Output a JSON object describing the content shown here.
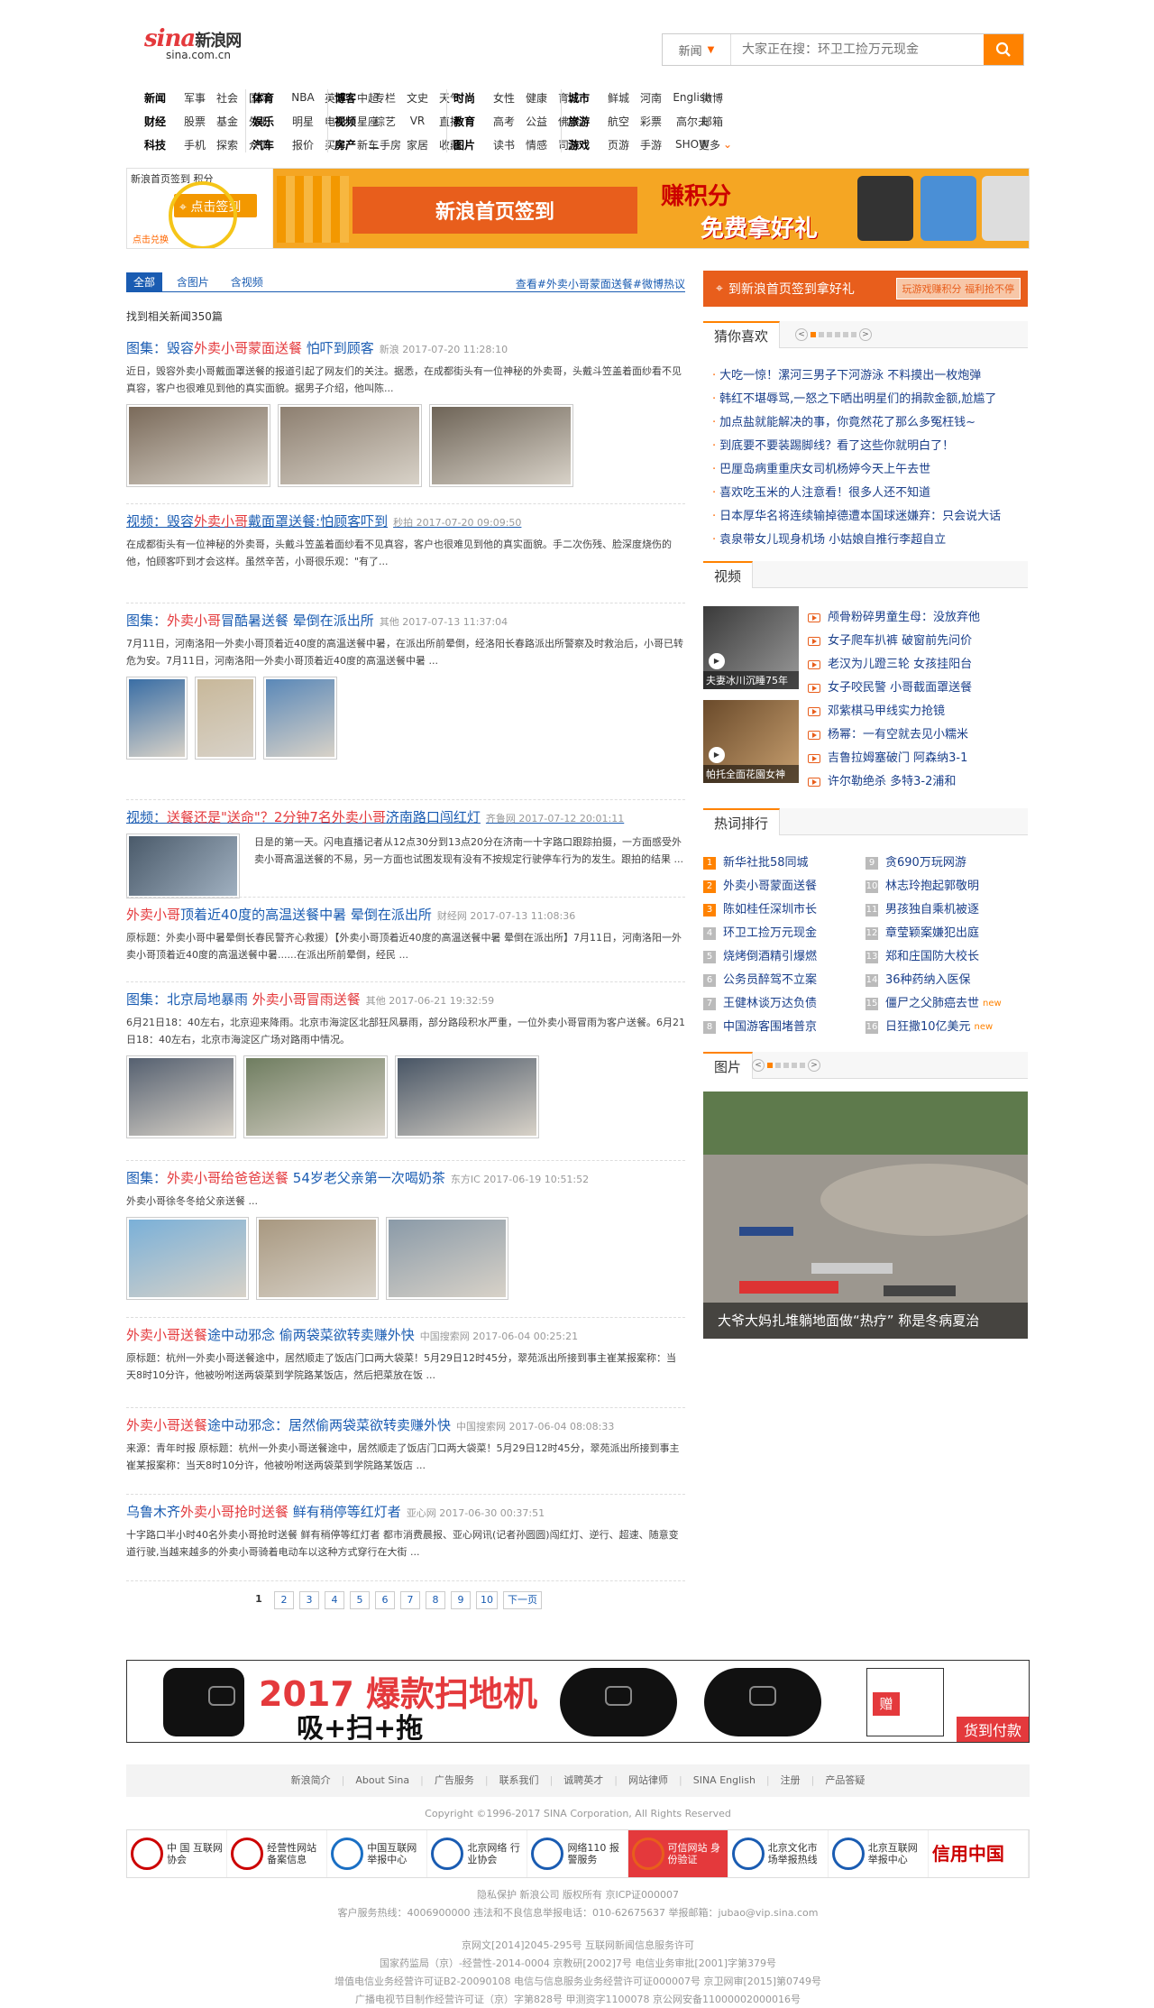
{
  "logo": {
    "brand": "sina",
    "cn": "新浪网",
    "domain": "sina.com.cn"
  },
  "search": {
    "category": "新闻",
    "placeholder": "大家正在搜：环卫工捡万元现金"
  },
  "nav": {
    "g1": [
      [
        "新闻",
        "军事",
        "社会",
        "国际"
      ],
      [
        "财经",
        "股票",
        "基金",
        "外汇"
      ],
      [
        "科技",
        "手机",
        "探索",
        "众测"
      ]
    ],
    "g2": [
      [
        "体育",
        "NBA",
        "英超",
        "中超"
      ],
      [
        "娱乐",
        "明星",
        "电影",
        "星座"
      ],
      [
        "汽车",
        "报价",
        "买车",
        "新车"
      ]
    ],
    "g3": [
      [
        "博客",
        "专栏",
        "文史",
        "天气"
      ],
      [
        "视频",
        "综艺",
        "VR",
        "直播"
      ],
      [
        "房产",
        "二手房",
        "家居",
        "收藏"
      ]
    ],
    "g4": [
      [
        "时尚",
        "女性",
        "健康",
        "育儿"
      ],
      [
        "教育",
        "高考",
        "公益",
        "佛学"
      ],
      [
        "图片",
        "读书",
        "情感",
        "司法"
      ]
    ],
    "g5": [
      [
        "城市",
        "鲜城",
        "河南",
        "English"
      ],
      [
        "旅游",
        "航空",
        "彩票",
        "高尔夫"
      ],
      [
        "游戏",
        "页游",
        "手游",
        "SHOW"
      ]
    ],
    "g6": [
      "微博",
      "邮箱",
      "更多"
    ]
  },
  "banner": {
    "top_text": "新浪首页签到  积分",
    "click": "点击签到",
    "small": "点击兑换",
    "main": "新浪首页签到",
    "big1": "赚积分",
    "big2": "免费拿好礼"
  },
  "tabs": [
    "全部",
    "含图片",
    "含视频"
  ],
  "tabs_right": "查看#外卖小哥蒙面送餐#微博热议",
  "count": "找到相关新闻350篇",
  "results": [
    {
      "title_a": "图集：毁容",
      "title_b": "外卖小哥蒙面送餐",
      "title_c": " 怕吓到顾客",
      "src": "新浪 2017-07-20 11:28:10",
      "desc": "近日，毁容外卖小哥戴面罩送餐的报道引起了网友们的关注。据悉，在成都街头有一位神秘的外卖哥，头戴斗笠盖着面纱看不见真容，客户也很难见到他的真实面貌。据男子介绍，他叫陈..."
    },
    {
      "title_a": "视频：毁容",
      "title_b": "外卖小哥",
      "title_c": "戴面罩送餐:怕顾客吓到",
      "src": "秒拍 2017-07-20 09:09:50",
      "desc": "在成都街头有一位神秘的外卖哥，头戴斗笠盖着面纱看不见真容，客户也很难见到他的真实面貌。手二次伤残、脸深度烧伤的他，怕顾客吓到才会这样。虽然辛苦，小哥很乐观：\"有了..."
    },
    {
      "title_a": "图集：",
      "title_b": "外卖小哥",
      "title_c": "冒酷暑送餐 晕倒在派出所",
      "src": "其他 2017-07-13 11:37:04",
      "desc": "7月11日，河南洛阳一外卖小哥顶着近40度的高温送餐中暑，在派出所前晕倒，经洛阳长春路派出所警察及时救治后，小哥已转危为安。7月11日，河南洛阳一外卖小哥顶着近40度的高温送餐中暑 ..."
    },
    {
      "title_a": "视频：",
      "title_b": "送餐还是\"送命\"？2分钟7名外卖小哥",
      "title_c": "济南路口闯红灯",
      "src": "齐鲁网 2017-07-12 20:01:11",
      "desc": "日是的第一天。闪电直播记者从12点30分到13点20分在济南一十字路口跟踪拍摄，一方面感受外卖小哥高温送餐的不易，另一方面也试图发现有没有不按规定行驶停车行为的发生。跟拍的结果 ..."
    },
    {
      "title_a": "",
      "title_b": "外卖小哥",
      "title_c": "顶着近40度的高温送餐中暑 晕倒在派出所",
      "src": "财经网 2017-07-13 11:08:36",
      "desc": "原标题：外卖小哥中暑晕倒长春民警齐心救援）【外卖小哥顶着近40度的高温送餐中暑 晕倒在派出所】7月11日，河南洛阳一外卖小哥顶着近40度的高温送餐中暑......在派出所前晕倒，经民 ..."
    },
    {
      "title_a": "图集：北京局地暴雨 ",
      "title_b": "外卖小哥冒雨送餐",
      "title_c": "",
      "src": "其他 2017-06-21 19:32:59",
      "desc": "6月21日18：40左右，北京迎来降雨。北京市海淀区北部狂风暴雨，部分路段积水严重，一位外卖小哥冒雨为客户送餐。6月21日18：40左右，北京市海淀区广场对路雨中情况。"
    },
    {
      "title_a": "图集：",
      "title_b": "外卖小哥给爸爸送餐",
      "title_c": " 54岁老父亲第一次喝奶茶",
      "src": "东方IC 2017-06-19 10:51:52",
      "desc": "外卖小哥徐冬冬给父亲送餐 ..."
    },
    {
      "title_a": "",
      "title_b": "外卖小哥送餐",
      "title_c": "途中动邪念 偷两袋菜欲转卖赚外快",
      "src": "中国搜索网 2017-06-04 00:25:21",
      "desc": "原标题：杭州一外卖小哥送餐途中，居然顺走了饭店门口两大袋菜！5月29日12时45分，翠苑派出所接到事主崔某报案称：当天8时10分许，他被吩咐送两袋菜到学院路某饭店，然后把菜放在饭 ..."
    },
    {
      "title_a": "",
      "title_b": "外卖小哥送餐",
      "title_c": "途中动邪念：居然偷两袋菜欲转卖赚外快",
      "src": "中国搜索网 2017-06-04 08:08:33",
      "desc": "来源：青年时报 原标题：杭州一外卖小哥送餐途中，居然顺走了饭店门口两大袋菜！5月29日12时45分，翠苑派出所接到事主崔某报案称：当天8时10分许，他被吩咐送两袋菜到学院路某饭店 ..."
    },
    {
      "title_a": "乌鲁木齐",
      "title_b": "外卖小哥抢时送餐",
      "title_c": " 鲜有稍停等红灯者",
      "src": "亚心网 2017-06-30 00:37:51",
      "desc": "十字路口半小时40名外卖小哥抢时送餐 鲜有稍停等红灯者 都市消费晨报、亚心网讯(记者孙圆圆)闯红灯、逆行、超速、随意变道行驶,当越来越多的外卖小哥骑着电动车以这种方式穿行在大街 ..."
    }
  ],
  "pager": [
    "1",
    "2",
    "3",
    "4",
    "5",
    "6",
    "7",
    "8",
    "9",
    "10",
    "下一页"
  ],
  "right": {
    "sign": "到新浪首页签到拿好礼",
    "sign_sub": "玩游戏赚积分 福利抢不停",
    "guess_title": "猜你喜欢",
    "guess": [
      "大吃一惊！漯河三男子下河游泳 不料摸出一枚炮弹",
      "韩红不堪辱骂,一怒之下晒出明星们的捐款金额,尬尴了",
      "加点盐就能解决的事，你竟然花了那么多冤枉钱~",
      "到底要不要装踢脚线？看了这些你就明白了！",
      "巴厘岛病重重庆女司机杨婷今天上午去世",
      "喜欢吃玉米的人注意看！很多人还不知道",
      "日本厚华名将连续输掉德遭本国球迷嫌弃：只会说大话",
      "袁泉带女儿现身机场 小姑娘自推行李超自立"
    ],
    "video_title": "视频",
    "video_caps": [
      "夫妻冰川沉睡75年",
      "帕托全面花園女神"
    ],
    "video": [
      "颅骨粉碎男童生母：没放弃他",
      "女子爬车扒裤 破窗前先问价",
      "老汉为儿蹬三轮 女孩挂阳台",
      "女子咬民警 小哥截面罩送餐",
      "邓紫棋马甲线实力抢镜",
      "杨幂：一有空就去见小糯米",
      "吉鲁拉姆塞破门 阿森纳3-1",
      "许尔勒绝杀 多特3-2浦和"
    ],
    "hot_title": "热词排行",
    "hot_left": [
      "新华社批58同城",
      "外卖小哥蒙面送餐",
      "陈如桂任深圳市长",
      "环卫工捡万元现金",
      "烧烤倒酒精引爆燃",
      "公务员醉驾不立案",
      "王健林谈万达负债",
      "中国游客围堵普京"
    ],
    "hot_right": [
      "贪690万玩网游",
      "林志玲抱起郭敬明",
      "男孩独自乘机被逐",
      "章莹颖案嫌犯出庭",
      "郑和庄国防大校长",
      "36种药纳入医保",
      "僵尸之父肺癌去世",
      "日狂撒10亿美元"
    ],
    "new_label": "new",
    "pic_title": "图片",
    "pic_cap": "大爷大妈扎堆躺地面做“热疗” 称是冬病夏治"
  },
  "ad": {
    "t1": "2017 爆款扫地机",
    "t2": "吸+扫+拖",
    "pay": "货到付款",
    "gift": "赠"
  },
  "footer": {
    "links": [
      "新浪简介",
      "About Sina",
      "广告服务",
      "联系我们",
      "诚聘英才",
      "网站律师",
      "SINA English",
      "注册",
      "产品答疑"
    ],
    "copy": "Copyright ©1996-2017 SINA Corporation, All Rights Reserved",
    "badges": [
      "中 国 互联网协会",
      "经营性网站 备案信息",
      "中国互联网 举报中心",
      "北京网络 行业协会",
      "网络110 报警服务",
      "可信网站 身份验证",
      "北京文化市 场举报热线",
      "北京互联网 举报中心",
      "信用中国"
    ],
    "l1": "隐私保护  新浪公司  版权所有  京ICP证000007",
    "l2": "客户服务热线：4006900000  违法和不良信息举报电话：010-62675637  举报邮箱：jubao@vip.sina.com",
    "l3": "京网文[2014]2045-295号  互联网新闻信息服务许可",
    "l4": "国家药监局（京）-经营性-2014-0004  京教研[2002]7号  电信业务审批[2001]字第379号",
    "l5": "增值电信业务经营许可证B2-20090108  电信与信息服务业务经营许可证000007号  京卫网审[2015]第0749号",
    "l6": "广播电视节目制作经营许可证（京）字第828号 甲测资字1100078 京公网安备11000002000016号"
  },
  "colors": {
    "accent": "#ff8200",
    "link": "#1a5cb2",
    "keyword": "#e4393c"
  }
}
